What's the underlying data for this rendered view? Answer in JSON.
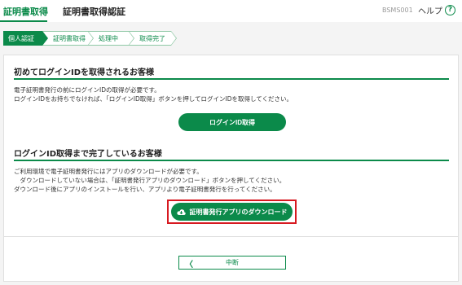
{
  "header": {
    "app_title": "証明書取得",
    "page_title": "証明書取得認証",
    "screen_id": "BSMS001",
    "help_label": "ヘルプ",
    "help_icon_glyph": "?"
  },
  "steps": [
    {
      "label": "個人認証",
      "active": true
    },
    {
      "label": "証明書取得",
      "active": false
    },
    {
      "label": "処理中",
      "active": false
    },
    {
      "label": "取得完了",
      "active": false
    }
  ],
  "section1": {
    "title": "初めてログインIDを取得されるお客様",
    "text": "電子証明書発行の前にログインIDの取得が必要です。\nログインIDをお持ちでなければ、「ログインID取得」ボタンを押してログインIDを取得してください。",
    "button_label": "ログインID取得"
  },
  "section2": {
    "title": "ログインID取得まで完了しているお客様",
    "text": "ご利用環境で電子証明書発行にはアプリのダウンロードが必要です。\n　ダウンロードしていない場合は、「証明書発行アプリのダウンロード」ボタンを押してください。\nダウンロード後にアプリのインストールを行い、アプリより電子証明書発行を行ってください。",
    "button_label": "証明書発行アプリのダウンロード"
  },
  "footer": {
    "back_label": "中断",
    "back_icon_glyph": "〈"
  },
  "colors": {
    "brand_green": "#0b8a4a",
    "highlight_red": "#d71920"
  },
  "icons": {
    "download": "cloud-download-icon",
    "back": "chevron-left-icon",
    "help": "help-circle-icon"
  }
}
